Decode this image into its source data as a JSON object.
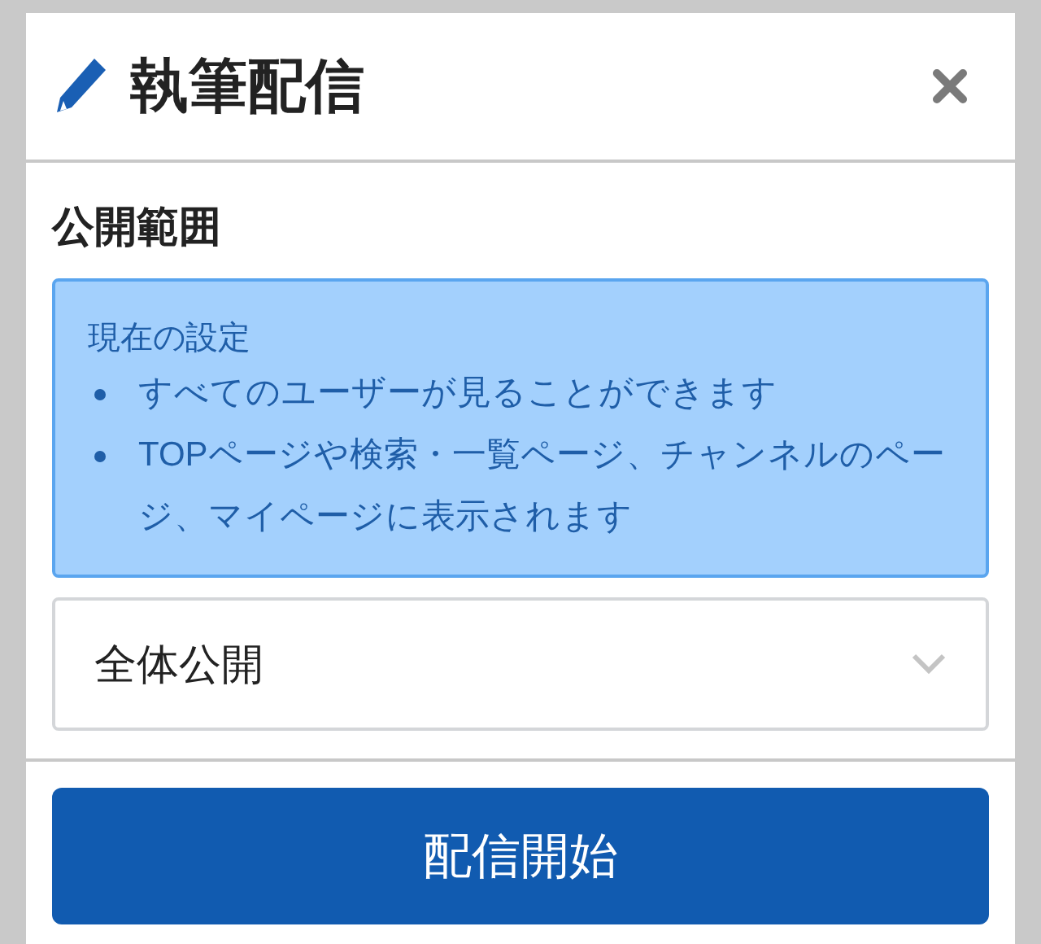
{
  "dialog": {
    "title": "執筆配信"
  },
  "visibility": {
    "heading": "公開範囲",
    "info": {
      "title": "現在の設定",
      "bullets": [
        "すべてのユーザーが見ることができます",
        "TOPページや検索・一覧ページ、チャンネルのページ、マイページに表示されます"
      ]
    },
    "select": {
      "value": "全体公開"
    }
  },
  "submit": {
    "label": "配信開始"
  }
}
